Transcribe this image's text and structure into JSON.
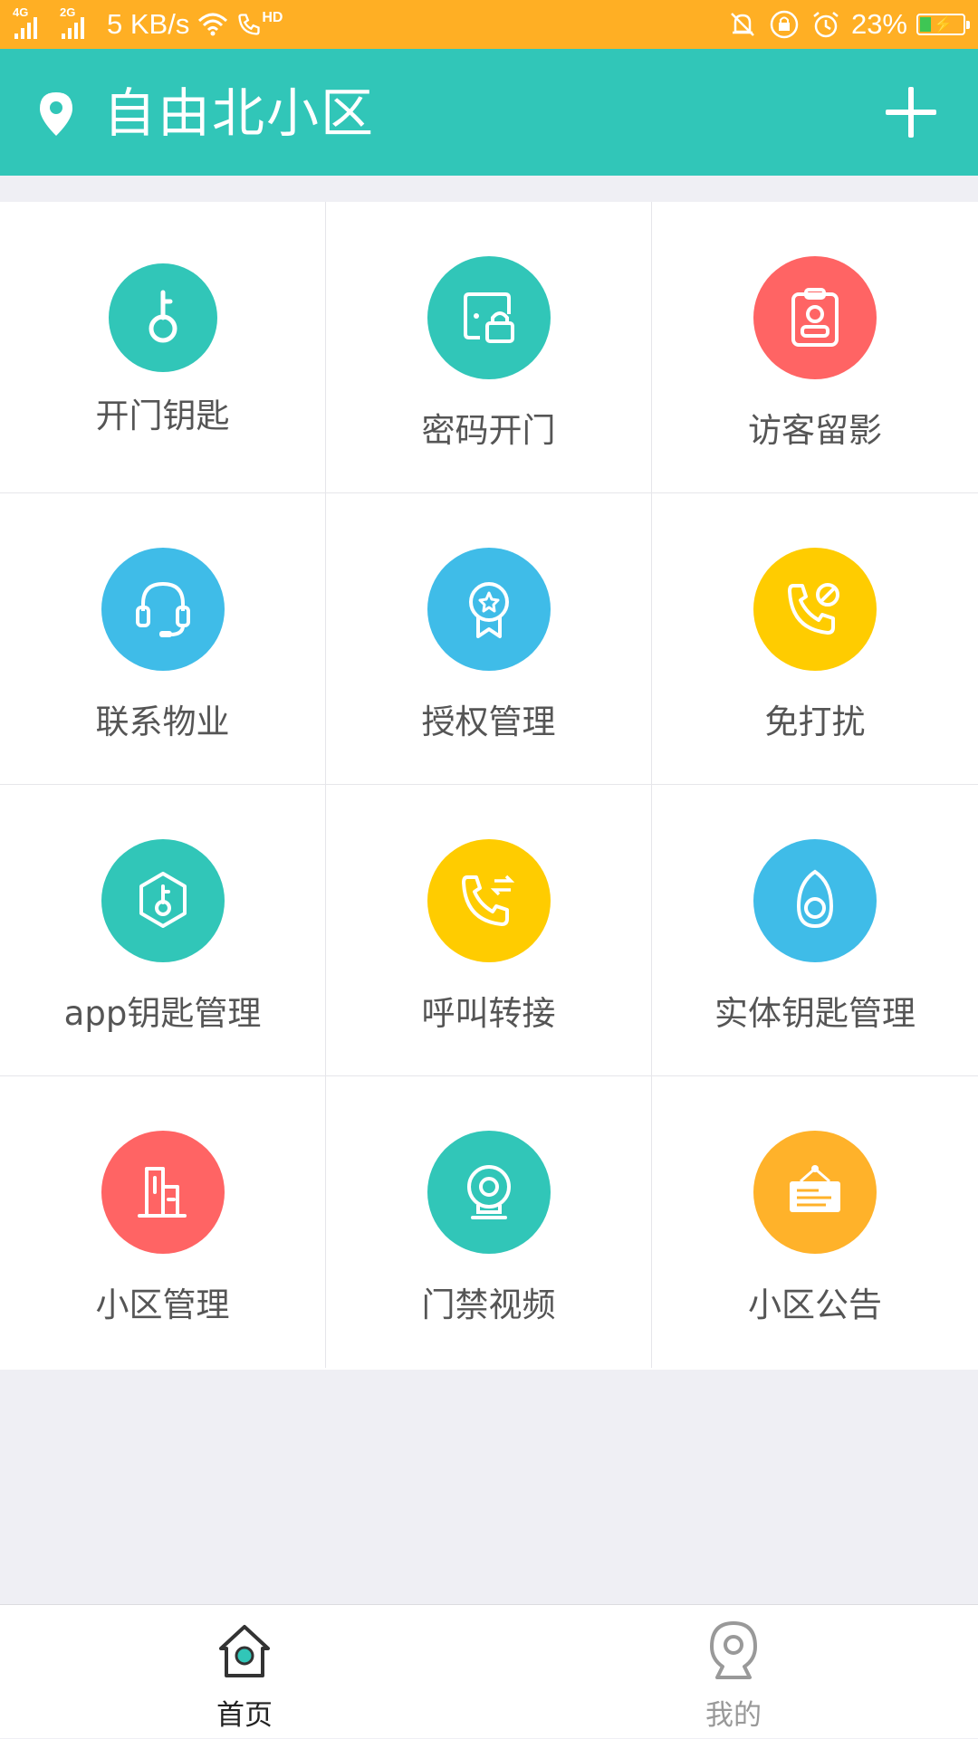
{
  "status_bar": {
    "network_1": "4G",
    "network_2": "2G",
    "speed": "5 KB/s",
    "hd": "HD",
    "battery": "23%",
    "icons": [
      "signal-icon",
      "signal-icon",
      "wifi-icon",
      "hd-call-icon",
      "mute-icon",
      "rotation-lock-icon",
      "alarm-icon",
      "battery-charging-icon"
    ]
  },
  "header": {
    "community_name": "自由北小区",
    "location_icon": "location-pin-icon",
    "add_icon": "plus-icon"
  },
  "grid": [
    {
      "label": "开门钥匙",
      "icon": "key-icon",
      "color": "#31c6b8"
    },
    {
      "label": "密码开门",
      "icon": "door-lock-icon",
      "color": "#31c6b8"
    },
    {
      "label": "访客留影",
      "icon": "visitor-badge-icon",
      "color": "#ff6464"
    },
    {
      "label": "联系物业",
      "icon": "headset-icon",
      "color": "#3fbce8"
    },
    {
      "label": "授权管理",
      "icon": "award-ribbon-icon",
      "color": "#3fbce8"
    },
    {
      "label": "免打扰",
      "icon": "phone-block-icon",
      "color": "#ffcc00"
    },
    {
      "label": "app钥匙管理",
      "icon": "hexagon-key-icon",
      "color": "#31c6b8"
    },
    {
      "label": "呼叫转接",
      "icon": "call-forward-icon",
      "color": "#ffcc00"
    },
    {
      "label": "实体钥匙管理",
      "icon": "key-fob-icon",
      "color": "#3fbce8"
    },
    {
      "label": "小区管理",
      "icon": "building-icon",
      "color": "#ff6464"
    },
    {
      "label": "门禁视频",
      "icon": "webcam-icon",
      "color": "#31c6b8"
    },
    {
      "label": "小区公告",
      "icon": "notice-board-icon",
      "color": "#ffb22a"
    }
  ],
  "tabbar": {
    "tabs": [
      {
        "label": "首页",
        "icon": "home-icon",
        "active": true
      },
      {
        "label": "我的",
        "icon": "profile-pin-icon",
        "active": false
      }
    ],
    "accent": "#31c6b8"
  }
}
